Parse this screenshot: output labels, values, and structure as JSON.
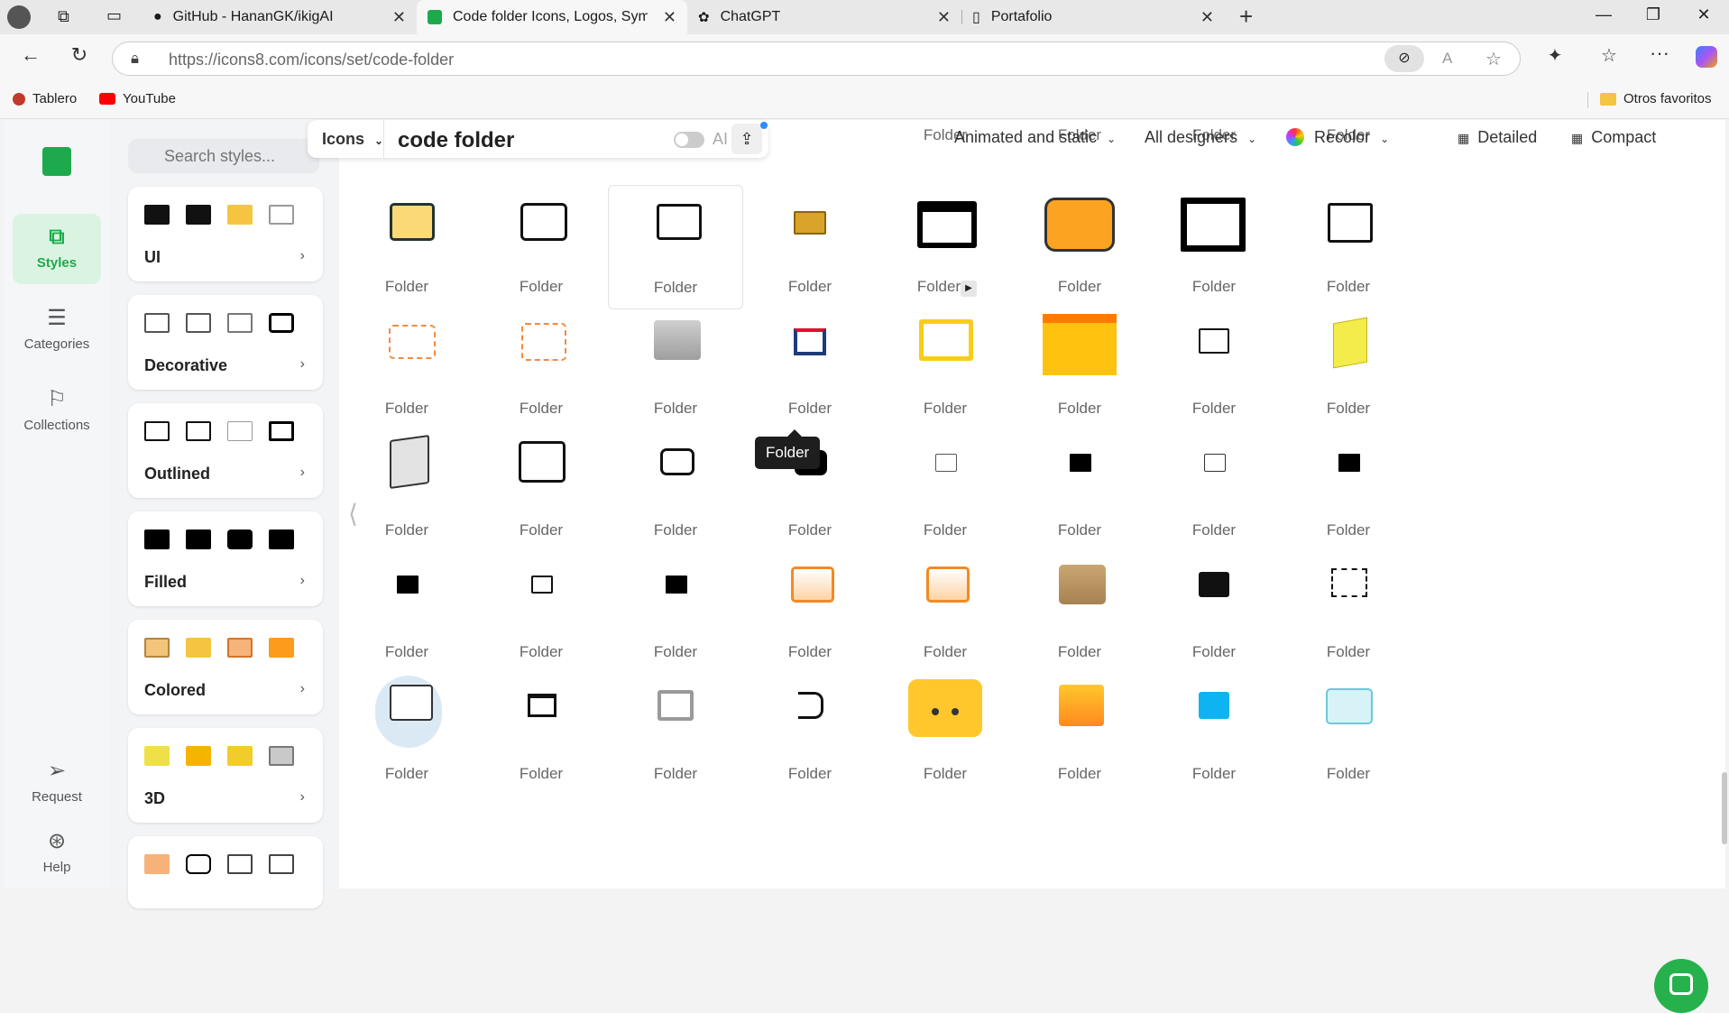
{
  "browser": {
    "tabs": [
      {
        "title": "GitHub - HananGK/ikigAI",
        "icon": "github-icon"
      },
      {
        "title": "Code folder Icons, Logos, Symbols",
        "icon": "icons8-icon"
      },
      {
        "title": "ChatGPT",
        "icon": "openai-icon"
      },
      {
        "title": "Portafolio",
        "icon": "page-icon"
      }
    ],
    "url": "https://icons8.com/icons/set/code-folder",
    "bookmarks": [
      {
        "label": "Tablero"
      },
      {
        "label": "YouTube"
      },
      {
        "label": "Otros favoritos"
      }
    ]
  },
  "rail": {
    "items": [
      {
        "label": "Styles"
      },
      {
        "label": "Categories"
      },
      {
        "label": "Collections"
      },
      {
        "label": "Request"
      },
      {
        "label": "Help"
      }
    ]
  },
  "styles": {
    "search_placeholder": "Search styles...",
    "cards": [
      {
        "label": "UI"
      },
      {
        "label": "Decorative"
      },
      {
        "label": "Outlined"
      },
      {
        "label": "Filled"
      },
      {
        "label": "Colored"
      },
      {
        "label": "3D"
      }
    ]
  },
  "filters": {
    "type": "Icons",
    "query": "code folder",
    "ai": "AI",
    "animation": "Animated and static",
    "designers": "All designers",
    "recolor": "Recolor",
    "detailed": "Detailed",
    "compact": "Compact"
  },
  "grid": {
    "label": "Folder",
    "tooltip": "Folder"
  },
  "colors": {
    "accent": "#1eaa4c",
    "folder_yellow": "#f7c93a",
    "folder_orange": "#fb9c1c"
  }
}
